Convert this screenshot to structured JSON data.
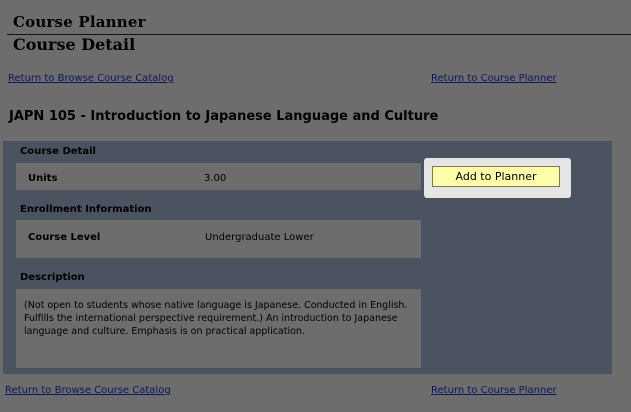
{
  "header": {
    "app_title": "Course Planner",
    "page_title": "Course Detail"
  },
  "nav": {
    "return_catalog": "Return to Browse Course Catalog",
    "return_planner": "Return to Course Planner"
  },
  "course": {
    "title": "JAPN 105 - Introduction to Japanese Language and Culture"
  },
  "detail": {
    "section_title": "Course Detail",
    "units_label": "Units",
    "units_value": "3.00"
  },
  "enrollment": {
    "section_title": "Enrollment Information",
    "level_label": "Course Level",
    "level_value": "Undergraduate Lower"
  },
  "description": {
    "section_title": "Description",
    "text": "(Not open to students whose native language is Japanese. Conducted in English. Fulfills the international perspective requirement.) An introduction to Japanese language and culture. Emphasis is on practical application."
  },
  "actions": {
    "add_to_planner": "Add to Planner"
  },
  "colors": {
    "page_background": "#6d6d6d",
    "panel_background": "#4b5260",
    "button_background": "#fefeaa",
    "link_color": "#0b1560"
  }
}
